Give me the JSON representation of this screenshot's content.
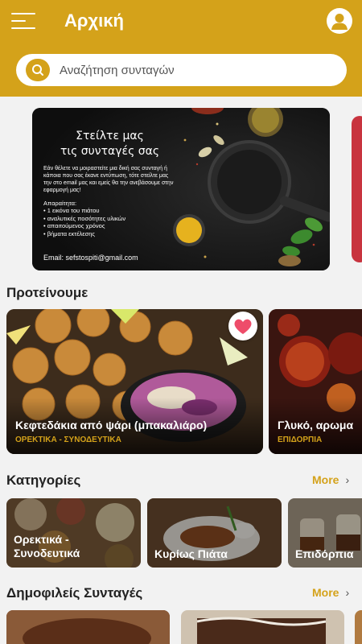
{
  "header": {
    "title": "Αρχική",
    "accent_color": "#d4a21a",
    "menu_icon": "hamburger-menu-icon",
    "profile_icon": "user-account-icon"
  },
  "search": {
    "placeholder": "Αναζήτηση συνταγών",
    "value": "",
    "icon": "search-icon"
  },
  "banner": {
    "title_line1": "Στείλτε μας",
    "title_line2": "τις συνταγές σας",
    "body": "Εάν θέλετε να μοιραστείτε μια δική σας συνταγή ή κάποια που σας έκανε εντύπωση, τότε στείλτε μας την στο email μας και εμείς θα την ανεβάσουμε στην εφαρμογή μας!",
    "requirements_label": "Απαραίτητα:",
    "requirements": [
      "1 εικόνα του πιάτου",
      "αναλυτικές ποσότητες υλικών",
      "απαιτούμενος χρόνος",
      "βήματα εκτέλεσης"
    ],
    "email": "Email: sefstospiti@gmail.com"
  },
  "recommended": {
    "title": "Προτείνουμε",
    "items": [
      {
        "name": "Κεφτεδάκια από ψάρι (μπακαλιάρο)",
        "category": "ΟΡΕΚΤΙΚΑ - ΣΥΝΟΔΕΥΤΙΚΑ",
        "favorite": true
      },
      {
        "name": "Γλυκό, αρωμα",
        "category": "ΕΠΙΔΟΡΠΙΑ",
        "favorite": false
      }
    ]
  },
  "categories": {
    "title": "Κατηγορίες",
    "more_label": "More",
    "items": [
      {
        "line1": "Ορεκτικά -",
        "line2": "Συνοδευτικά"
      },
      {
        "line1": "Κυρίως Πιάτα",
        "line2": ""
      },
      {
        "line1": "Επιδόρπια",
        "line2": ""
      }
    ]
  },
  "popular": {
    "title": "Δημοφιλείς Συνταγές",
    "more_label": "More"
  }
}
